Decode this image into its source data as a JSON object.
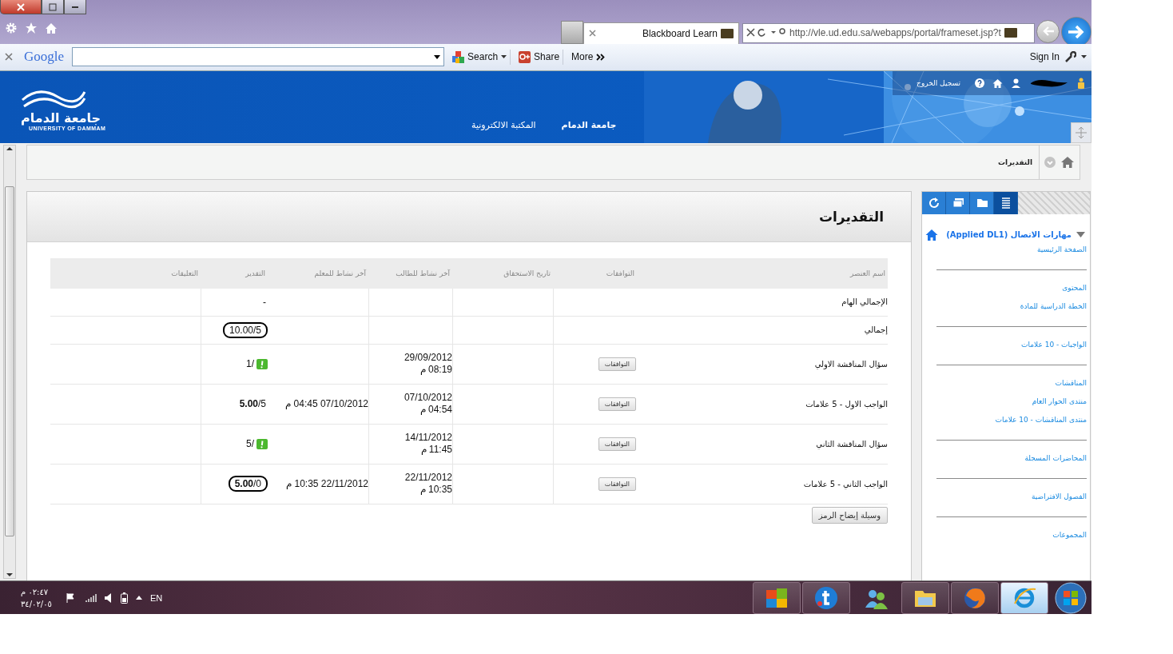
{
  "browser": {
    "tab_title": "Blackboard Learn",
    "url": "http://vle.ud.edu.sa/webapps/portal/frameset.jsp?t"
  },
  "toolbar": {
    "logo": "Google",
    "search_label": "Search",
    "share_label": "Share",
    "more_label": "More",
    "sign_in": "Sign In"
  },
  "banner": {
    "logo_arabic": "جامعة الدمام",
    "logo_english": "UNIVERSITY OF DAMMAM",
    "logout": "تسجيل الخروج",
    "nav": [
      {
        "label": "جامعة الدمام",
        "selected": true
      },
      {
        "label": "المكتبة الالكترونية",
        "selected": false
      }
    ]
  },
  "breadcrumb": "التقديرات",
  "page_title": "التقديرات",
  "table": {
    "columns": [
      "اسم العنصر",
      "التوافقات",
      "تاريخ الاستحقاق",
      "آخر نشاط للطالب",
      "آخر نشاط للمعلم",
      "التقدير",
      "التعليقات"
    ],
    "rows": [
      {
        "name": "الإجمالي الهام",
        "grade": {
          "text": "-",
          "needs_grading": false,
          "circled": false
        }
      },
      {
        "name": "إجمالي",
        "grade": {
          "text": "10.00/5",
          "needs_grading": false,
          "circled": true
        }
      },
      {
        "name": "سؤال المناقشة الاولي",
        "alignments": "التوافقات",
        "student_activity": {
          "date": "29/09/2012",
          "time": "08:19 م"
        },
        "grade": {
          "text": "1/",
          "needs_grading": true,
          "circled": false
        }
      },
      {
        "name": "الواجب الاول - 5 علامات",
        "alignments": "التوافقات",
        "student_activity": {
          "date": "07/10/2012",
          "time": "04:54 م"
        },
        "teacher_activity": "07/10/2012 04:45 م",
        "grade": {
          "text": "**5.00**/5",
          "needs_grading": false,
          "circled": false
        }
      },
      {
        "name": "سؤال المناقشة الثاني",
        "alignments": "التوافقات",
        "student_activity": {
          "date": "14/11/2012",
          "time": "11:45 م"
        },
        "grade": {
          "text": "5/",
          "needs_grading": true,
          "circled": false
        }
      },
      {
        "name": "الواجب الثاني - 5 علامات",
        "alignments": "التوافقات",
        "student_activity": {
          "date": "22/11/2012",
          "time": "10:35 م"
        },
        "teacher_activity": "22/11/2012 10:35 م",
        "grade": {
          "text": "**5.00**/0",
          "needs_grading": false,
          "circled": true
        }
      }
    ]
  },
  "legend_button": "وسيلة إيضاح الرمز",
  "sidebar": {
    "tool_tabs": [
      {
        "kind": "refresh",
        "selected": false
      },
      {
        "kind": "windows",
        "selected": false
      },
      {
        "kind": "folder",
        "selected": false
      },
      {
        "kind": "list",
        "selected": true
      }
    ],
    "course_title": "مهارات الاتصال (Applied DL1)",
    "groups": [
      [
        "الصفحة الرئيسية"
      ],
      [
        "المحتوى",
        "الخطة الدراسية للمادة"
      ],
      [
        "الواجبات - 10 علامات"
      ],
      [
        "المناقشات",
        "منتدى الحوار العام",
        "منتدى المناقشات - 10 علامات"
      ],
      [
        "المحاضرات المسجلة"
      ],
      [
        "الفصول الافتراضية"
      ],
      [
        "المجموعات"
      ]
    ]
  },
  "taskbar": {
    "time": "٠٢:٤٧ م",
    "date": "٣٤/٠٢/٠٥",
    "language": "EN"
  }
}
